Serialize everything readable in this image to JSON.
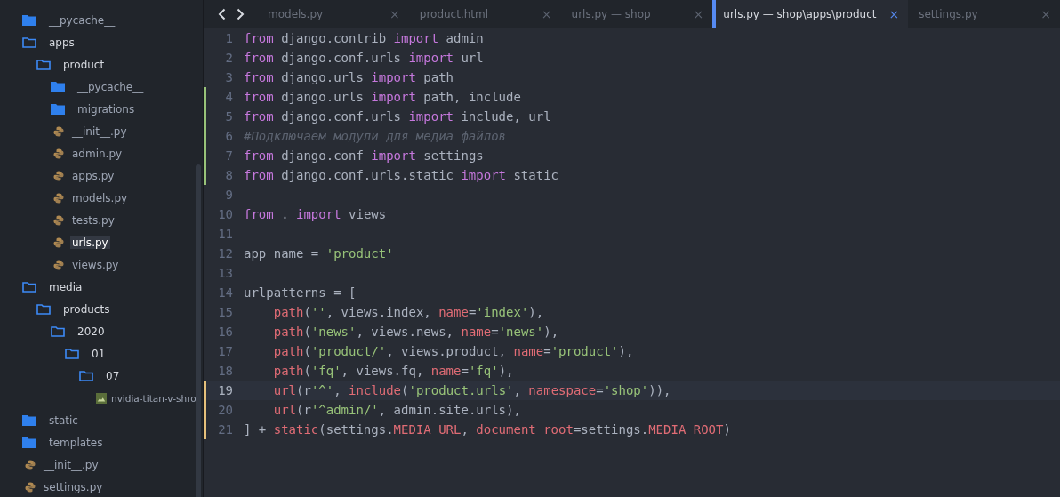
{
  "sidebar": {
    "tree": [
      {
        "name": "__pycache__",
        "kind": "folder",
        "expanded": false,
        "selected": false
      },
      {
        "name": "apps",
        "kind": "folder",
        "expanded": true,
        "selected": false,
        "children": [
          {
            "name": "product",
            "kind": "folder",
            "expanded": true,
            "selected": false,
            "children": [
              {
                "name": "__pycache__",
                "kind": "folder",
                "expanded": false,
                "selected": false
              },
              {
                "name": "migrations",
                "kind": "folder",
                "expanded": false,
                "selected": false
              },
              {
                "name": "__init__.py",
                "kind": "python",
                "selected": false
              },
              {
                "name": "admin.py",
                "kind": "python",
                "selected": false
              },
              {
                "name": "apps.py",
                "kind": "python",
                "selected": false
              },
              {
                "name": "models.py",
                "kind": "python",
                "selected": false
              },
              {
                "name": "tests.py",
                "kind": "python",
                "selected": false
              },
              {
                "name": "urls.py",
                "kind": "python",
                "selected": true
              },
              {
                "name": "views.py",
                "kind": "python",
                "selected": false
              }
            ]
          }
        ]
      },
      {
        "name": "media",
        "kind": "folder",
        "expanded": true,
        "selected": false,
        "children": [
          {
            "name": "products",
            "kind": "folder",
            "expanded": true,
            "selected": false,
            "children": [
              {
                "name": "2020",
                "kind": "folder",
                "expanded": true,
                "selected": false,
                "children": [
                  {
                    "name": "01",
                    "kind": "folder",
                    "expanded": true,
                    "selected": false,
                    "children": [
                      {
                        "name": "07",
                        "kind": "folder",
                        "expanded": true,
                        "selected": false,
                        "children": [
                          {
                            "name": "nvidia-titan-v-shro",
                            "kind": "image",
                            "selected": false
                          }
                        ]
                      }
                    ]
                  }
                ]
              }
            ]
          }
        ]
      },
      {
        "name": "static",
        "kind": "folder",
        "expanded": false,
        "selected": false
      },
      {
        "name": "templates",
        "kind": "folder",
        "expanded": false,
        "selected": false
      },
      {
        "name": "__init__.py",
        "kind": "python",
        "selected": false
      },
      {
        "name": "settings.py",
        "kind": "python",
        "selected": false
      }
    ]
  },
  "tabs": [
    {
      "label": "models.py",
      "selected": false,
      "close": "×"
    },
    {
      "label": "product.html",
      "selected": false,
      "close": "×"
    },
    {
      "label": "urls.py — shop",
      "selected": false,
      "close": "×"
    },
    {
      "label": "urls.py — shop\\apps\\product",
      "selected": true,
      "close": "×"
    },
    {
      "label": "settings.py",
      "selected": false,
      "close": "×"
    }
  ],
  "editor": {
    "lines": [
      {
        "number": "1",
        "kind": "unchanged",
        "current": false,
        "tokens": [
          {
            "text": "from",
            "kind": "keyword"
          },
          {
            "text": " django.contrib ",
            "kind": "plain"
          },
          {
            "text": "import",
            "kind": "keyword"
          },
          {
            "text": " admin",
            "kind": "plain"
          }
        ]
      },
      {
        "number": "2",
        "kind": "unchanged",
        "current": false,
        "tokens": [
          {
            "text": "from",
            "kind": "keyword"
          },
          {
            "text": " django.conf.urls ",
            "kind": "plain"
          },
          {
            "text": "import",
            "kind": "keyword"
          },
          {
            "text": " url",
            "kind": "plain"
          }
        ]
      },
      {
        "number": "3",
        "kind": "unchanged",
        "current": false,
        "tokens": [
          {
            "text": "from",
            "kind": "keyword"
          },
          {
            "text": " django.urls ",
            "kind": "plain"
          },
          {
            "text": "import",
            "kind": "keyword"
          },
          {
            "text": " path",
            "kind": "plain"
          }
        ]
      },
      {
        "number": "4",
        "kind": "added",
        "current": false,
        "tokens": [
          {
            "text": "from",
            "kind": "keyword"
          },
          {
            "text": " django.urls ",
            "kind": "plain"
          },
          {
            "text": "import",
            "kind": "keyword"
          },
          {
            "text": " path, include",
            "kind": "plain"
          }
        ]
      },
      {
        "number": "5",
        "kind": "added",
        "current": false,
        "tokens": [
          {
            "text": "from",
            "kind": "keyword"
          },
          {
            "text": " django.conf.urls ",
            "kind": "plain"
          },
          {
            "text": "import",
            "kind": "keyword"
          },
          {
            "text": " include, url",
            "kind": "plain"
          }
        ]
      },
      {
        "number": "6",
        "kind": "added",
        "current": false,
        "tokens": [
          {
            "text": "#Подключаем модули для медиа файлов",
            "kind": "comment"
          }
        ]
      },
      {
        "number": "7",
        "kind": "added",
        "current": false,
        "tokens": [
          {
            "text": "from",
            "kind": "keyword"
          },
          {
            "text": " django.conf ",
            "kind": "plain"
          },
          {
            "text": "import",
            "kind": "keyword"
          },
          {
            "text": " settings",
            "kind": "plain"
          }
        ]
      },
      {
        "number": "8",
        "kind": "added",
        "current": false,
        "tokens": [
          {
            "text": "from",
            "kind": "keyword"
          },
          {
            "text": " django.conf.urls.static ",
            "kind": "plain"
          },
          {
            "text": "import",
            "kind": "keyword"
          },
          {
            "text": " static",
            "kind": "plain"
          }
        ]
      },
      {
        "number": "9",
        "kind": "unchanged",
        "current": false
      },
      {
        "number": "10",
        "kind": "unchanged",
        "current": false,
        "tokens": [
          {
            "text": "from",
            "kind": "keyword"
          },
          {
            "text": " . ",
            "kind": "plain"
          },
          {
            "text": "import",
            "kind": "keyword"
          },
          {
            "text": " views",
            "kind": "plain"
          }
        ]
      },
      {
        "number": "11",
        "kind": "unchanged",
        "current": false
      },
      {
        "number": "12",
        "kind": "unchanged",
        "current": false,
        "tokens": [
          {
            "text": "app_name = ",
            "kind": "plain"
          },
          {
            "text": "'product'",
            "kind": "string"
          }
        ]
      },
      {
        "number": "13",
        "kind": "unchanged",
        "current": false
      },
      {
        "number": "14",
        "kind": "unchanged",
        "current": false,
        "tokens": [
          {
            "text": "urlpatterns = [",
            "kind": "plain"
          }
        ]
      },
      {
        "number": "15",
        "kind": "unchanged",
        "current": false,
        "tokens": [
          {
            "text": "    path",
            "kind": "call"
          },
          {
            "text": "(",
            "kind": "plain"
          },
          {
            "text": "''",
            "kind": "string"
          },
          {
            "text": ", views.index, ",
            "kind": "plain"
          },
          {
            "text": "name",
            "kind": "call"
          },
          {
            "text": "=",
            "kind": "plain"
          },
          {
            "text": "'index'",
            "kind": "string"
          },
          {
            "text": "),",
            "kind": "plain"
          }
        ]
      },
      {
        "number": "16",
        "kind": "unchanged",
        "current": false,
        "tokens": [
          {
            "text": "    path",
            "kind": "call"
          },
          {
            "text": "(",
            "kind": "plain"
          },
          {
            "text": "'news'",
            "kind": "string"
          },
          {
            "text": ", views.news, ",
            "kind": "plain"
          },
          {
            "text": "name",
            "kind": "call"
          },
          {
            "text": "=",
            "kind": "plain"
          },
          {
            "text": "'news'",
            "kind": "string"
          },
          {
            "text": "),",
            "kind": "plain"
          }
        ]
      },
      {
        "number": "17",
        "kind": "unchanged",
        "current": false,
        "tokens": [
          {
            "text": "    path",
            "kind": "call"
          },
          {
            "text": "(",
            "kind": "plain"
          },
          {
            "text": "'product/'",
            "kind": "string"
          },
          {
            "text": ", views.product, ",
            "kind": "plain"
          },
          {
            "text": "name",
            "kind": "call"
          },
          {
            "text": "=",
            "kind": "plain"
          },
          {
            "text": "'product'",
            "kind": "string"
          },
          {
            "text": "),",
            "kind": "plain"
          }
        ]
      },
      {
        "number": "18",
        "kind": "unchanged",
        "current": false,
        "tokens": [
          {
            "text": "    path",
            "kind": "call"
          },
          {
            "text": "(",
            "kind": "plain"
          },
          {
            "text": "'fq'",
            "kind": "string"
          },
          {
            "text": ", views.fq, ",
            "kind": "plain"
          },
          {
            "text": "name",
            "kind": "call"
          },
          {
            "text": "=",
            "kind": "plain"
          },
          {
            "text": "'fq'",
            "kind": "string"
          },
          {
            "text": "),",
            "kind": "plain"
          }
        ]
      },
      {
        "number": "19",
        "kind": "modified",
        "current": true,
        "tokens": [
          {
            "text": "    url",
            "kind": "call"
          },
          {
            "text": "(r",
            "kind": "plain"
          },
          {
            "text": "'^'",
            "kind": "string"
          },
          {
            "text": ", ",
            "kind": "plain"
          },
          {
            "text": "include",
            "kind": "call"
          },
          {
            "text": "(",
            "kind": "plain"
          },
          {
            "text": "'product.urls'",
            "kind": "string"
          },
          {
            "text": ", ",
            "kind": "plain"
          },
          {
            "text": "namespace",
            "kind": "call"
          },
          {
            "text": "=",
            "kind": "plain"
          },
          {
            "text": "'shop'",
            "kind": "string"
          },
          {
            "text": ")),",
            "kind": "plain"
          }
        ]
      },
      {
        "number": "20",
        "kind": "modified",
        "current": false,
        "tokens": [
          {
            "text": "    url",
            "kind": "call"
          },
          {
            "text": "(r",
            "kind": "plain"
          },
          {
            "text": "'^admin/'",
            "kind": "string"
          },
          {
            "text": ", admin.site.urls),",
            "kind": "plain"
          }
        ]
      },
      {
        "number": "21",
        "kind": "modified",
        "current": false,
        "tokens": [
          {
            "text": "] + ",
            "kind": "plain"
          },
          {
            "text": "static",
            "kind": "call"
          },
          {
            "text": "(settings.",
            "kind": "plain"
          },
          {
            "text": "MEDIA_URL",
            "kind": "call"
          },
          {
            "text": ", ",
            "kind": "plain"
          },
          {
            "text": "document_root",
            "kind": "call"
          },
          {
            "text": "=settings.",
            "kind": "plain"
          },
          {
            "text": "MEDIA_ROOT",
            "kind": "call"
          },
          {
            "text": ")",
            "kind": "plain"
          }
        ]
      }
    ]
  }
}
